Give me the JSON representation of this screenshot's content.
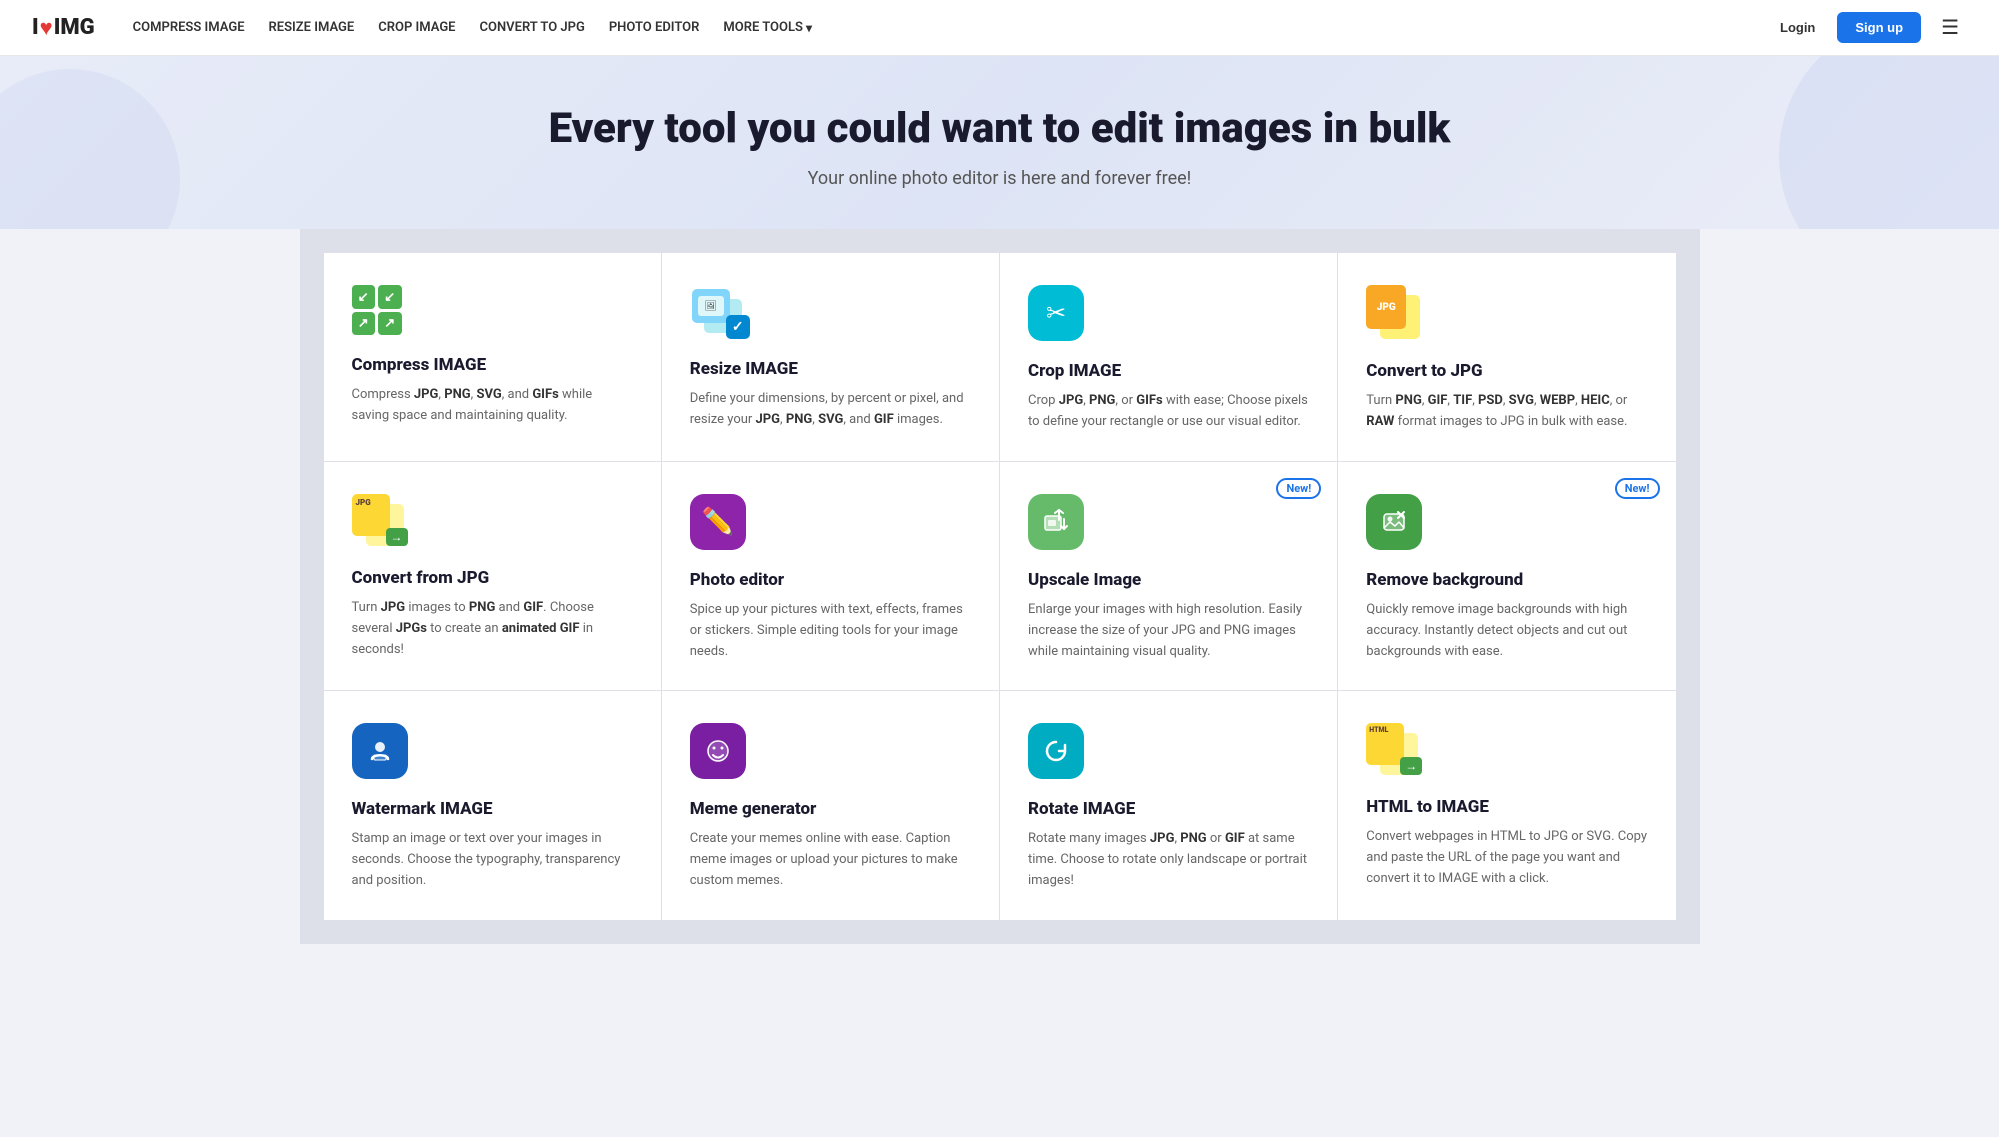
{
  "nav": {
    "logo_i": "I",
    "logo_heart": "♥",
    "logo_img": "IMG",
    "links": [
      {
        "label": "COMPRESS IMAGE",
        "id": "compress"
      },
      {
        "label": "RESIZE IMAGE",
        "id": "resize"
      },
      {
        "label": "CROP IMAGE",
        "id": "crop"
      },
      {
        "label": "CONVERT TO JPG",
        "id": "convert-to-jpg"
      },
      {
        "label": "PHOTO EDITOR",
        "id": "photo-editor"
      },
      {
        "label": "MORE TOOLS",
        "id": "more-tools"
      }
    ],
    "more_arrow": "▾",
    "login": "Login",
    "signup": "Sign up",
    "hamburger": "☰"
  },
  "hero": {
    "headline": "Every tool you could want to edit images in bulk",
    "subline": "Your online photo editor is here and forever free!"
  },
  "tools": [
    {
      "id": "compress",
      "title": "Compress IMAGE",
      "desc_parts": [
        {
          "text": "Compress "
        },
        {
          "text": "JPG",
          "bold": true
        },
        {
          "text": ", "
        },
        {
          "text": "PNG",
          "bold": true
        },
        {
          "text": ", "
        },
        {
          "text": "SVG",
          "bold": true
        },
        {
          "text": ", and "
        },
        {
          "text": "GIFs",
          "bold": true
        },
        {
          "text": " while saving space and maintaining quality."
        }
      ],
      "icon_type": "compress",
      "badge": null
    },
    {
      "id": "resize",
      "title": "Resize IMAGE",
      "desc_parts": [
        {
          "text": "Define your dimensions, by percent or pixel, and resize your "
        },
        {
          "text": "JPG",
          "bold": true
        },
        {
          "text": ", "
        },
        {
          "text": "PNG",
          "bold": true
        },
        {
          "text": ", "
        },
        {
          "text": "SVG",
          "bold": true
        },
        {
          "text": ", and "
        },
        {
          "text": "GIF",
          "bold": true
        },
        {
          "text": " images."
        }
      ],
      "icon_type": "resize",
      "badge": null
    },
    {
      "id": "crop",
      "title": "Crop IMAGE",
      "desc_parts": [
        {
          "text": "Crop "
        },
        {
          "text": "JPG",
          "bold": true
        },
        {
          "text": ", "
        },
        {
          "text": "PNG",
          "bold": true
        },
        {
          "text": ", or "
        },
        {
          "text": "GIFs",
          "bold": true
        },
        {
          "text": " with ease; Choose pixels to define your rectangle or use our visual editor."
        }
      ],
      "icon_type": "crop",
      "badge": null
    },
    {
      "id": "convert-to-jpg",
      "title": "Convert to JPG",
      "desc_parts": [
        {
          "text": "Turn "
        },
        {
          "text": "PNG",
          "bold": true
        },
        {
          "text": ", "
        },
        {
          "text": "GIF",
          "bold": true
        },
        {
          "text": ", "
        },
        {
          "text": "TIF",
          "bold": true
        },
        {
          "text": ", "
        },
        {
          "text": "PSD",
          "bold": true
        },
        {
          "text": ", "
        },
        {
          "text": "SVG",
          "bold": true
        },
        {
          "text": ", "
        },
        {
          "text": "WEBP",
          "bold": true
        },
        {
          "text": ", "
        },
        {
          "text": "HEIC",
          "bold": true
        },
        {
          "text": ", or "
        },
        {
          "text": "RAW",
          "bold": true
        },
        {
          "text": " format images to JPG in bulk with ease."
        }
      ],
      "icon_type": "convert-to-jpg",
      "badge": null
    },
    {
      "id": "convert-from-jpg",
      "title": "Convert from JPG",
      "desc_parts": [
        {
          "text": "Turn "
        },
        {
          "text": "JPG",
          "bold": true
        },
        {
          "text": " images to "
        },
        {
          "text": "PNG",
          "bold": true
        },
        {
          "text": " and "
        },
        {
          "text": "GIF",
          "bold": true
        },
        {
          "text": ". Choose several "
        },
        {
          "text": "JPGs",
          "bold": true
        },
        {
          "text": " to create an "
        },
        {
          "text": "animated GIF",
          "bold": true
        },
        {
          "text": " in seconds!"
        }
      ],
      "icon_type": "convert-from-jpg",
      "badge": null
    },
    {
      "id": "photo-editor",
      "title": "Photo editor",
      "desc_parts": [
        {
          "text": "Spice up your pictures with text, effects, frames or stickers. Simple editing tools for your image needs."
        }
      ],
      "icon_type": "photo-editor",
      "badge": null
    },
    {
      "id": "upscale",
      "title": "Upscale Image",
      "desc_parts": [
        {
          "text": "Enlarge your images with high resolution. Easily increase the size of your JPG and PNG images while maintaining visual quality."
        }
      ],
      "icon_type": "upscale",
      "badge": "New!"
    },
    {
      "id": "remove-bg",
      "title": "Remove background",
      "desc_parts": [
        {
          "text": "Quickly remove image backgrounds with high accuracy. Instantly detect objects and cut out backgrounds with ease."
        }
      ],
      "icon_type": "remove-bg",
      "badge": "New!"
    },
    {
      "id": "watermark",
      "title": "Watermark IMAGE",
      "desc_parts": [
        {
          "text": "Stamp an image or text over your images in seconds. Choose the typography, transparency and position."
        }
      ],
      "icon_type": "watermark",
      "badge": null
    },
    {
      "id": "meme",
      "title": "Meme generator",
      "desc_parts": [
        {
          "text": "Create your memes online with ease. Caption meme images or upload your pictures to make custom memes."
        }
      ],
      "icon_type": "meme",
      "badge": null
    },
    {
      "id": "rotate",
      "title": "Rotate IMAGE",
      "desc_parts": [
        {
          "text": "Rotate many images "
        },
        {
          "text": "JPG",
          "bold": true
        },
        {
          "text": ", "
        },
        {
          "text": "PNG",
          "bold": true
        },
        {
          "text": " or "
        },
        {
          "text": "GIF",
          "bold": true
        },
        {
          "text": " at same time. Choose to rotate only landscape or portrait images!"
        }
      ],
      "icon_type": "rotate",
      "badge": null
    },
    {
      "id": "html-to-image",
      "title": "HTML to IMAGE",
      "desc_parts": [
        {
          "text": "Convert webpages in HTML to JPG or SVG. Copy and paste the URL of the page you want and convert it to IMAGE with a click."
        }
      ],
      "icon_type": "html-to-image",
      "badge": null
    }
  ]
}
